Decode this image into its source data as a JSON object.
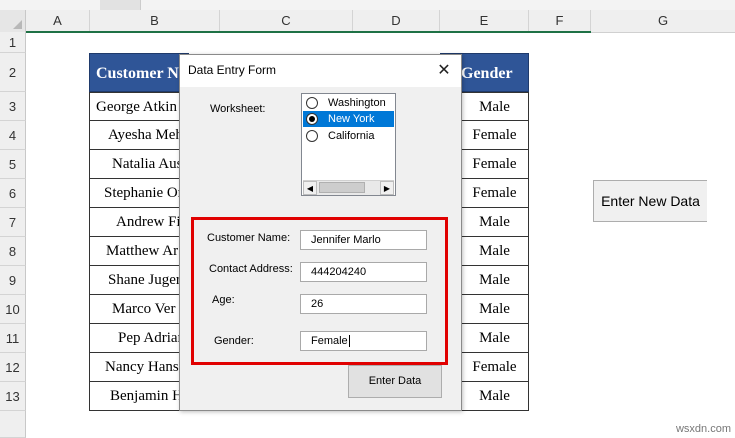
{
  "columns": [
    "A",
    "B",
    "C",
    "D",
    "E",
    "F",
    "G"
  ],
  "rows": [
    "1",
    "2",
    "3",
    "4",
    "5",
    "6",
    "7",
    "8",
    "9",
    "10",
    "11",
    "12",
    "13"
  ],
  "table": {
    "headers": {
      "customer": "Customer N",
      "gender": "Gender"
    },
    "customers": [
      "George Atkin",
      "Ayesha Meh",
      "Natalia Aus",
      "Stephanie Or",
      "Andrew Fi",
      "Matthew Ar",
      "Shane Juger",
      "Marco Ver",
      "Pep Adrian",
      "Nancy Hans",
      "Benjamin H"
    ],
    "genders": [
      "Male",
      "Female",
      "Female",
      "Female",
      "Male",
      "Male",
      "Male",
      "Male",
      "Male",
      "Female",
      "Male"
    ]
  },
  "side_button": {
    "label": "Enter New Data"
  },
  "dialog": {
    "title": "Data Entry Form",
    "close": "✕",
    "worksheet_label": "Worksheet:",
    "worksheets": [
      "Washington",
      "New York",
      "California"
    ],
    "selected_worksheet": "New York",
    "scroll_left": "◀",
    "scroll_right": "▶",
    "fields": {
      "name_label": "Customer Name:",
      "name_value": "Jennifer Marlo",
      "address_label": "Contact Address:",
      "address_value": "444204240",
      "age_label": "Age:",
      "age_value": "26",
      "gender_label": "Gender:",
      "gender_value": "Female"
    },
    "submit_label": "Enter Data"
  },
  "watermark": "wsxdn.com",
  "colors": {
    "header_fill": "#2f5597",
    "highlight_box": "#e00000",
    "selection": "#0078d7",
    "grid_accent": "#1e7145"
  }
}
